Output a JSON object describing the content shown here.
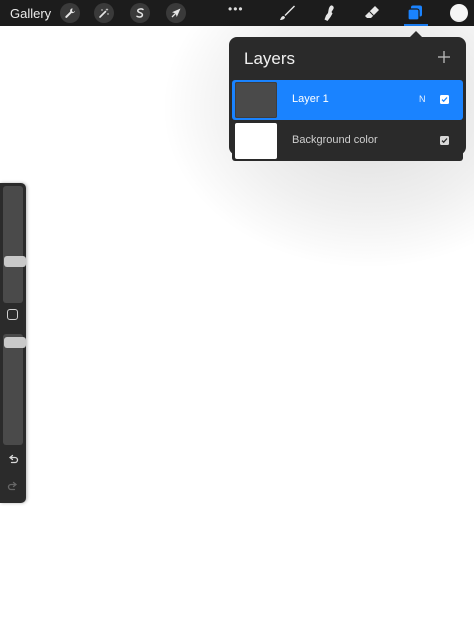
{
  "toolbar": {
    "gallery_label": "Gallery",
    "more_label": "•••",
    "left_tools": [
      {
        "icon": "wrench-icon",
        "name": "actions"
      },
      {
        "icon": "magic-wand-icon",
        "name": "adjustments"
      },
      {
        "icon": "selection-s-icon",
        "name": "selection"
      },
      {
        "icon": "arrow-cursor-icon",
        "name": "transform"
      }
    ],
    "right_tools": [
      {
        "icon": "brush-icon",
        "name": "paint"
      },
      {
        "icon": "smudge-icon",
        "name": "smudge"
      },
      {
        "icon": "eraser-icon",
        "name": "erase"
      },
      {
        "icon": "layers-icon",
        "name": "layers",
        "active": true
      }
    ],
    "current_color": "#f5f5f5",
    "accent_color": "#1a83ff"
  },
  "layers_panel": {
    "title": "Layers",
    "add_icon": "plus-icon",
    "layers": [
      {
        "name": "Layer 1",
        "blend_mode": "N",
        "visible": true,
        "selected": true
      },
      {
        "name": "Background color",
        "visible": true,
        "selected": false
      }
    ]
  },
  "sidebar": {
    "brush_size_level": 0.34,
    "opacity_level": 0.97,
    "modify_icon": "square-icon",
    "undo_icon": "undo-arrow-icon",
    "redo_icon": "redo-arrow-icon"
  }
}
